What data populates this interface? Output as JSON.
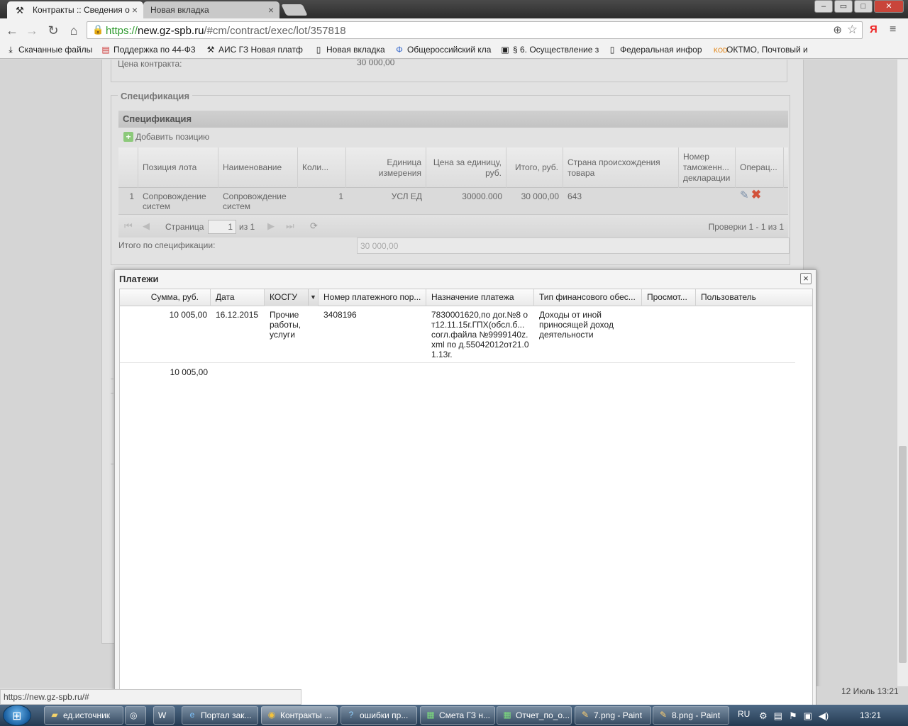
{
  "browser": {
    "tabs": [
      {
        "title": "Контракты :: Сведения о",
        "close": "×"
      },
      {
        "title": "Новая вкладка",
        "close": "×"
      }
    ],
    "window_buttons": [
      "‒",
      "▭",
      "□",
      "✕"
    ],
    "url": {
      "scheme": "https://",
      "host": "new.gz-spb.ru",
      "path": "/#cm/contract/exec/lot/357818"
    },
    "yandex_label": "Я",
    "bookmarks": [
      {
        "label": "Скачанные файлы",
        "icon": "download-icon"
      },
      {
        "label": "Поддержка по 44-Ф3",
        "icon": "bookmark-icon"
      },
      {
        "label": "АИС ГЗ Новая платф",
        "icon": "tools-icon"
      },
      {
        "label": "Новая вкладка",
        "icon": "page-icon"
      },
      {
        "label": "Общероссийский кла",
        "icon": "phi-icon"
      },
      {
        "label": "§ 6. Осуществление з",
        "icon": "book-icon"
      },
      {
        "label": "Федеральная инфор",
        "icon": "page-icon"
      },
      {
        "label": "ОКТМО, Почтовый и",
        "icon": "kod-icon"
      }
    ]
  },
  "contract": {
    "price_label": "Цена контракта:",
    "price_value": "30 000,00"
  },
  "spec": {
    "legend": "Спецификация",
    "panel_title": "Спецификация",
    "add_position": "Добавить позицию",
    "columns": [
      "Позиция лота",
      "Наименование",
      "Коли...",
      "Единица измерения",
      "Цена за единицу, руб.",
      "Итого, руб.",
      "Страна происхождения товара",
      "Номер таможенн... декларации",
      "Операц..."
    ],
    "rows": [
      {
        "num": "1",
        "lot_position": "Сопровождение систем",
        "name": "Сопровождение систем",
        "qty": "1",
        "unit": "УСЛ ЕД",
        "price": "30000.000",
        "total": "30 000,00",
        "country": "643",
        "customs": ""
      }
    ],
    "pager": {
      "page_label": "Страница",
      "page_value": "1",
      "of_label": "из 1",
      "summary": "Проверки 1 - 1 из 1"
    },
    "total_label": "Итого по спецификации:",
    "total_value": "30 000,00"
  },
  "payments": {
    "title": "Платежи",
    "columns": [
      "Сумма, руб.",
      "Дата",
      "КОСГУ",
      "Номер платежного пор...",
      "Назначение платежа",
      "Тип финансового обес...",
      "Просмот...",
      "Пользователь"
    ],
    "rows": [
      {
        "sum": "10 005,00",
        "date": "16.12.2015",
        "kosgu": "Прочие работы, услуги",
        "order_no": "3408196",
        "purpose": "7830001620,по дог.№8 от12.11.15г.ГПХ(обсл.б... согл.файла №9999140z.xml по д.55042012от21.01.13г.",
        "finance_type": "Доходы от иной приносящей доход деятельности",
        "viewed": "",
        "user": ""
      }
    ],
    "sum_total": "10 005,00"
  },
  "status": {
    "hover_url": "https://new.gz-spb.ru/#",
    "page_date": "12 Июль 13:21"
  },
  "taskbar": {
    "items": [
      {
        "label": "ед.источник",
        "icon": "folder-icon"
      },
      {
        "label": "",
        "icon": "app-icon"
      },
      {
        "label": "",
        "icon": "word-icon"
      },
      {
        "label": "Портал зак...",
        "icon": "ie-icon"
      },
      {
        "label": "Контракты ...",
        "icon": "chrome-icon"
      },
      {
        "label": "ошибки пр...",
        "icon": "help-icon"
      },
      {
        "label": "Смета ГЗ н...",
        "icon": "excel-icon"
      },
      {
        "label": "Отчет_по_о...",
        "icon": "excel-icon"
      },
      {
        "label": "7.png - Paint",
        "icon": "paint-icon"
      },
      {
        "label": "8.png - Paint",
        "icon": "paint-icon"
      }
    ],
    "lang": "RU",
    "time": "13:21"
  }
}
